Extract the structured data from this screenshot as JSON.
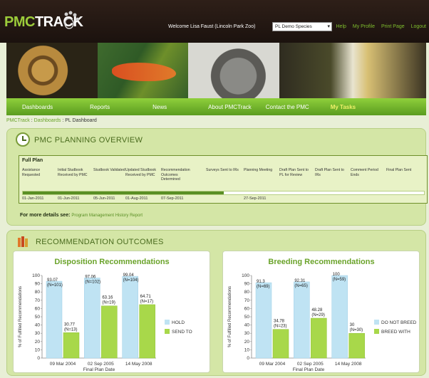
{
  "header": {
    "logo": {
      "prefix": "PMC",
      "suffix": "TRACK"
    },
    "welcome": "Welcome Lisa Faust (Lincoln Park Zoo)",
    "species_select": {
      "value": "PL Demo Species"
    },
    "links": [
      "Help",
      "My Profile",
      "Print Page",
      "Logout"
    ]
  },
  "nav": {
    "items": [
      "Dashboards",
      "Reports",
      "News",
      "About PMCTrack",
      "Contact the PMC",
      "My Tasks"
    ]
  },
  "breadcrumb": {
    "items": [
      "PMCTrack",
      "Dashboards",
      "PL Dashboard"
    ],
    "separator": ":"
  },
  "planning": {
    "title": "PMC PLANNING OVERVIEW",
    "full_plan_label": "Full Plan",
    "steps": [
      {
        "label": "Assistance Requested",
        "date": "01-Jan-2011"
      },
      {
        "label": "Initial Studbook Received by PMC",
        "date": "01-Jun-2011"
      },
      {
        "label": "Studbook Validated",
        "date": "05-Jun-2011"
      },
      {
        "label": "Updated Studbook Received by PMC",
        "date": "01-Aug-2011"
      },
      {
        "label": "Recommendation Outcomes Determined",
        "date": "07-Sep-2011"
      },
      {
        "label": "Surveys Sent to IRs",
        "date": ""
      },
      {
        "label": "Planning Meeting",
        "date": "27-Sep-2011"
      },
      {
        "label": "Draft Plan Sent to PL for Review",
        "date": ""
      },
      {
        "label": "Draft Plan Sent to IRs",
        "date": ""
      },
      {
        "label": "Comment Period Ends",
        "date": ""
      },
      {
        "label": "Final Plan Sent",
        "date": ""
      }
    ],
    "progress_fraction": 0.5,
    "details_label": "For more details see:",
    "details_link": "Program Management History Report"
  },
  "outcomes": {
    "title": "RECOMMENDATION OUTCOMES"
  },
  "colors": {
    "accent": "#5a9c1f",
    "series_blue": "#bfe3f3",
    "series_green": "#a8d84a"
  },
  "chart_data": [
    {
      "type": "bar",
      "title": "Disposition Recommendations",
      "xlabel": "Final Plan Date",
      "ylabel": "% of Fulfilled Recommendations",
      "categories": [
        "09 Mar 2004",
        "02 Sep 2005",
        "14 May 2008"
      ],
      "ylim": [
        0,
        100
      ],
      "yticks": [
        0,
        10,
        20,
        30,
        40,
        50,
        60,
        70,
        80,
        90,
        100
      ],
      "legend_position": "right",
      "series": [
        {
          "name": "HOLD",
          "values": [
            93.07,
            97.06,
            99.04
          ],
          "labels": [
            "93.07\n(N=101)",
            "97.06\n(N=102)",
            "99.04\n(N=104)"
          ]
        },
        {
          "name": "SEND TO",
          "values": [
            30.77,
            63.16,
            64.71
          ],
          "labels": [
            "30.77\n(N=13)",
            "63.16\n(N=19)",
            "64.71\n(N=17)"
          ]
        }
      ]
    },
    {
      "type": "bar",
      "title": "Breeding Recommendations",
      "xlabel": "Final Plan Date",
      "ylabel": "% of Fulfilled Recommendations",
      "categories": [
        "09 Mar 2004",
        "02 Sep 2005",
        "14 May 2008"
      ],
      "ylim": [
        0,
        100
      ],
      "yticks": [
        0,
        10,
        20,
        30,
        40,
        50,
        60,
        70,
        80,
        90,
        100
      ],
      "legend_position": "right",
      "series": [
        {
          "name": "DO NOT BREED",
          "values": [
            91.3,
            92.31,
            100
          ],
          "labels": [
            "91.3\n(N=69)",
            "92.31\n(N=65)",
            "100\n(N=59)"
          ]
        },
        {
          "name": "BREED WITH",
          "values": [
            34.78,
            48.28,
            30
          ],
          "labels": [
            "34.78\n(N=23)",
            "48.28\n(N=29)",
            "30\n(N=30)"
          ]
        }
      ]
    }
  ]
}
